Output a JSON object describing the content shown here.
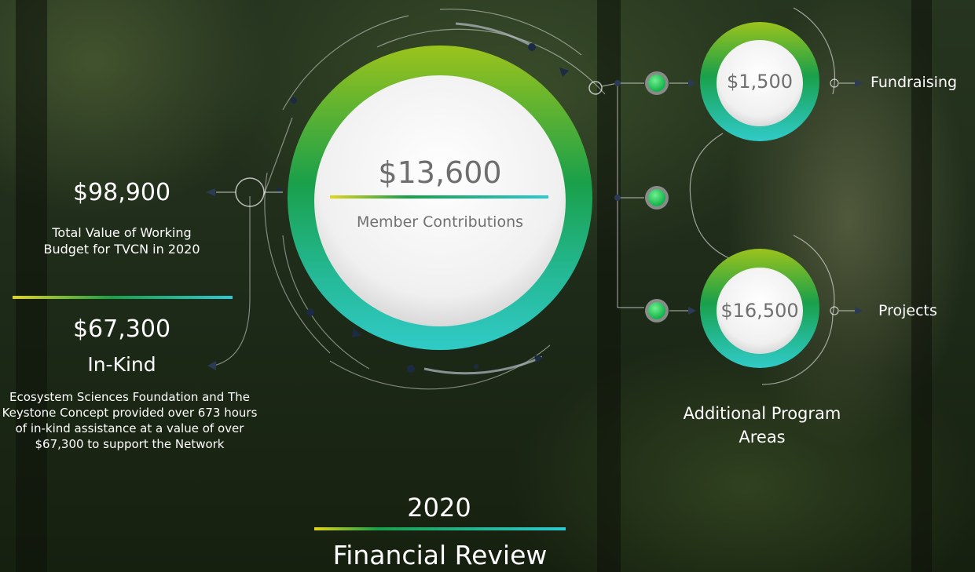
{
  "left": {
    "total_value": "$98,900",
    "total_desc": "Total Value of Working Budget for TVCN in 2020",
    "inkind_value": "$67,300",
    "inkind_title": "In-Kind",
    "inkind_desc": "Ecosystem Sciences Foundation and The Keystone Concept provided over 673 hours of in-kind assistance at a value of over $67,300 to support the Network"
  },
  "center": {
    "amount": "$13,600",
    "label": "Member Contributions"
  },
  "right": {
    "fundraising_amount": "$1,500",
    "fundraising_label": "Fundraising",
    "projects_amount": "$16,500",
    "projects_label": "Projects",
    "group_label": "Additional Program Areas"
  },
  "footer": {
    "year": "2020",
    "title": "Financial Review"
  },
  "colors": {
    "gradient_yellow": "#d6d21c",
    "gradient_green": "#1aa04a",
    "gradient_teal": "#2ec9c4",
    "node_green": "#22cc55",
    "text_gray": "#707070"
  }
}
